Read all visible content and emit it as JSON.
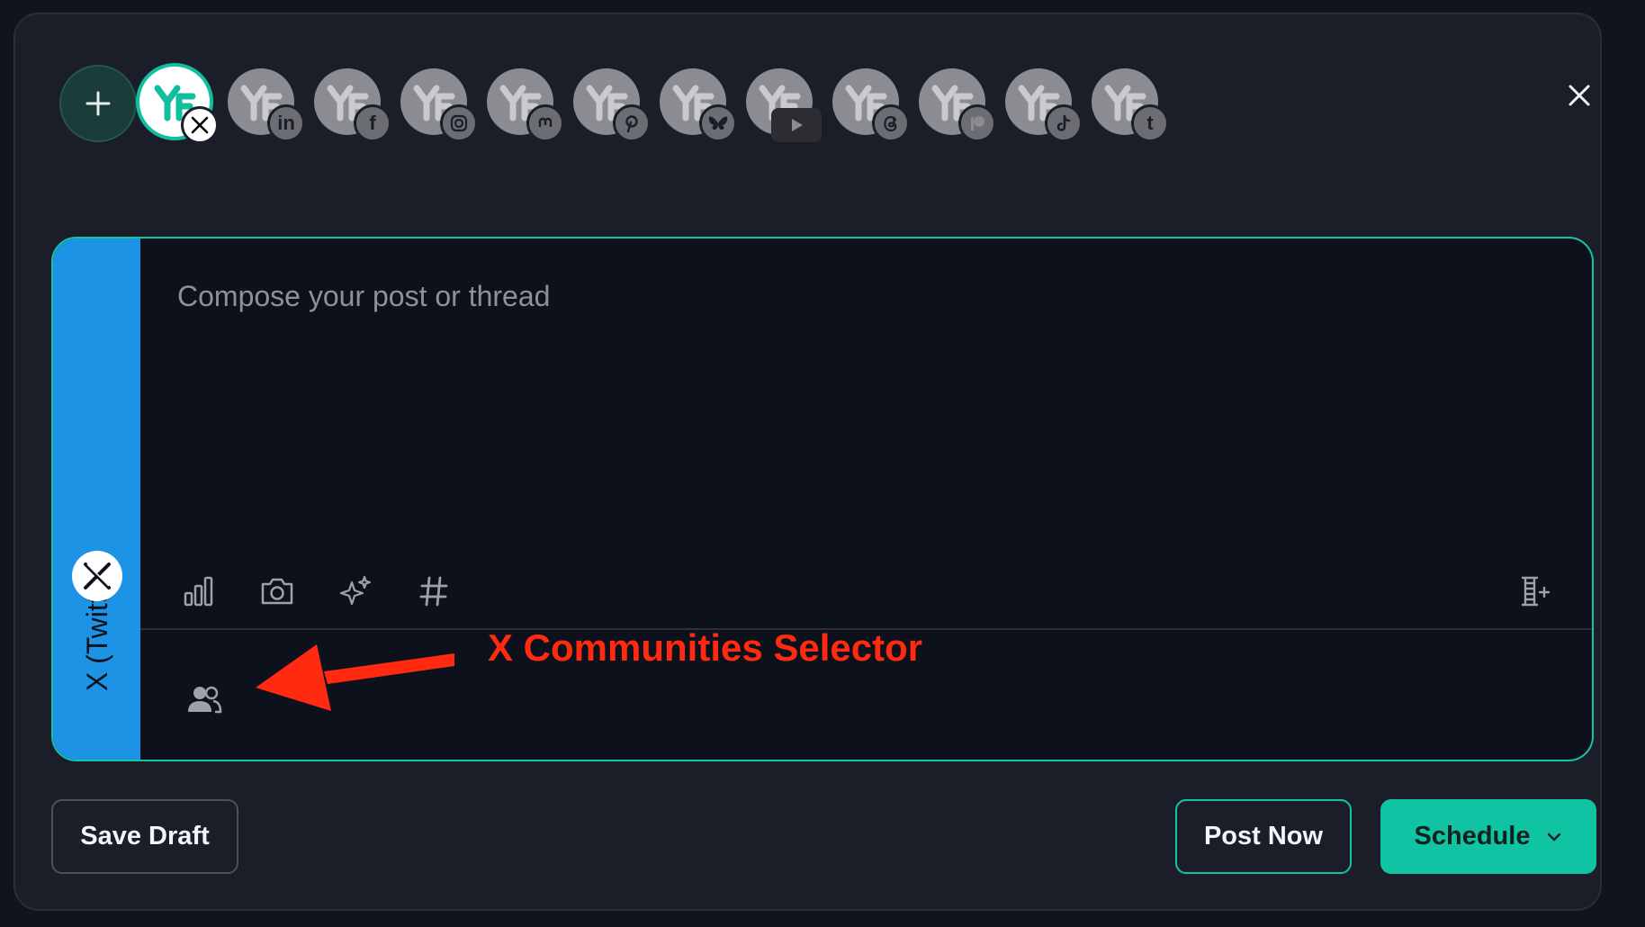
{
  "accounts": [
    {
      "name": "account-x",
      "platform": "X",
      "active": true,
      "badge_icon": "x-logo-icon"
    },
    {
      "name": "account-linkedin",
      "platform": "LinkedIn",
      "active": false,
      "badge_icon": "linkedin-icon",
      "badge_text": "in"
    },
    {
      "name": "account-facebook",
      "platform": "Facebook",
      "active": false,
      "badge_icon": "facebook-icon",
      "badge_text": "f"
    },
    {
      "name": "account-instagram",
      "platform": "Instagram",
      "active": false,
      "badge_icon": "instagram-icon"
    },
    {
      "name": "account-mastodon",
      "platform": "Mastodon",
      "active": false,
      "badge_icon": "mastodon-icon"
    },
    {
      "name": "account-pinterest",
      "platform": "Pinterest",
      "active": false,
      "badge_icon": "pinterest-icon"
    },
    {
      "name": "account-bluesky",
      "platform": "Bluesky",
      "active": false,
      "badge_icon": "bluesky-icon"
    },
    {
      "name": "account-youtube",
      "platform": "YouTube",
      "active": false,
      "badge_icon": "youtube-icon"
    },
    {
      "name": "account-threads",
      "platform": "Threads",
      "active": false,
      "badge_icon": "threads-icon"
    },
    {
      "name": "account-patreon",
      "platform": "Patreon",
      "active": false,
      "badge_icon": "patreon-icon"
    },
    {
      "name": "account-tiktok",
      "platform": "TikTok",
      "active": false,
      "badge_icon": "tiktok-icon"
    },
    {
      "name": "account-tumblr",
      "platform": "Tumblr",
      "active": false,
      "badge_icon": "tumblr-icon",
      "badge_text": "t"
    }
  ],
  "editor": {
    "platform_label": "X (Twitter)",
    "placeholder": "Compose your post or thread",
    "value": "",
    "accent_color": "#14c4a5",
    "strip_color": "#1d93e6",
    "toolbar": [
      "poll-icon",
      "camera-icon",
      "ai-sparkle-icon",
      "hashtag-icon",
      "thread-add-icon"
    ],
    "footer_tool": "communities-icon"
  },
  "annotation": {
    "text": "X Communities Selector",
    "color": "#ff2a0f"
  },
  "footer": {
    "save_draft": "Save Draft",
    "post_now": "Post Now",
    "schedule": "Schedule"
  }
}
